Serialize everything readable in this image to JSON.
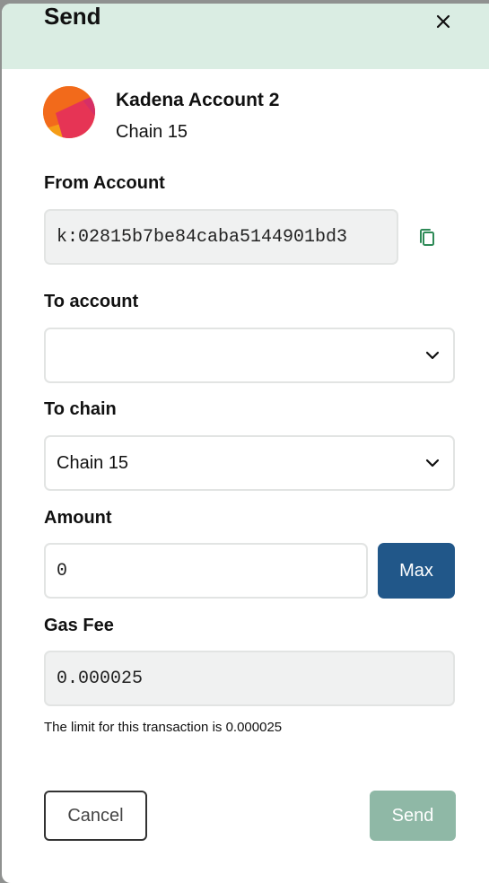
{
  "header": {
    "title": "Send",
    "close_icon": "close-icon"
  },
  "account": {
    "name": "Kadena Account 2",
    "chain": "Chain 15",
    "avatar_colors": [
      "#e63455",
      "#f26a1b",
      "#f59d16"
    ]
  },
  "from_account": {
    "label": "From Account",
    "value": "k:02815b7be84caba5144901bd3",
    "copy_icon": "copy-icon"
  },
  "to_account": {
    "label": "To account",
    "value": "",
    "dropdown_icon": "chevron-down-icon"
  },
  "to_chain": {
    "label": "To chain",
    "value": "Chain 15",
    "dropdown_icon": "chevron-down-icon"
  },
  "amount": {
    "label": "Amount",
    "value": "0",
    "max_label": "Max"
  },
  "gas_fee": {
    "label": "Gas Fee",
    "value": "0.000025",
    "helper": "The limit for this transaction is 0.000025"
  },
  "actions": {
    "cancel_label": "Cancel",
    "send_label": "Send"
  },
  "colors": {
    "header_bg": "#daede3",
    "primary": "#215789",
    "send_disabled": "#8fb8a6",
    "copy_icon": "#2e8a57"
  }
}
